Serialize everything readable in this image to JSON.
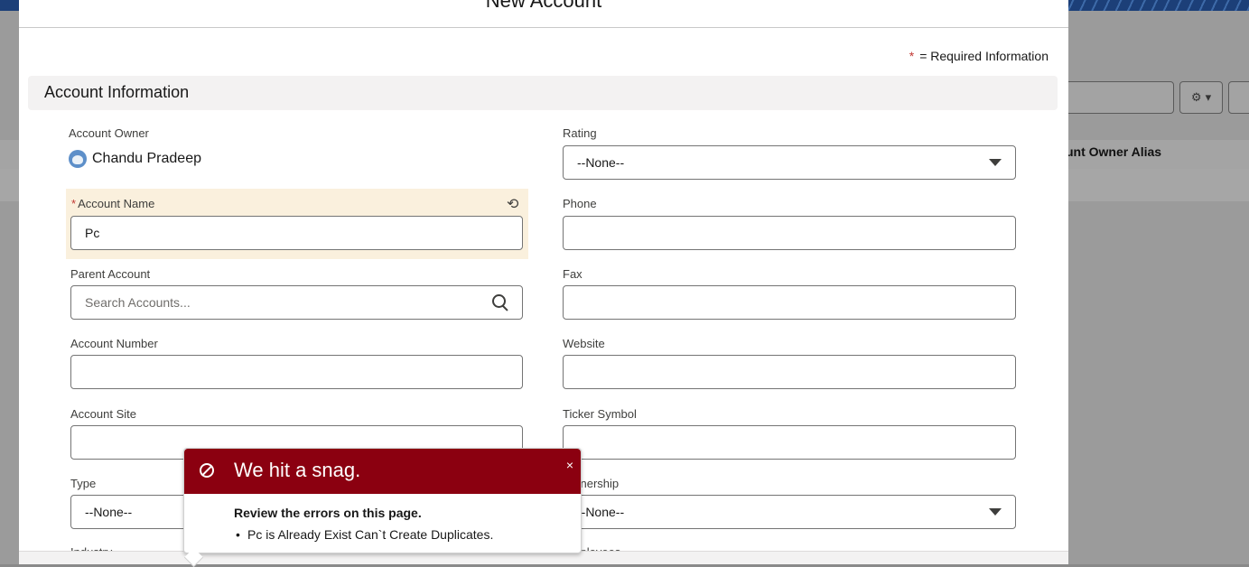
{
  "modal": {
    "title": "New Account",
    "required_star": "*",
    "required_text": "= Required Information",
    "section_title": "Account Information"
  },
  "fields": {
    "account_owner_label": "Account Owner",
    "account_owner_value": "Chandu Pradeep",
    "account_name_star": "*",
    "account_name_label": "Account Name",
    "account_name_value": "Pc",
    "parent_account_label": "Parent Account",
    "parent_account_placeholder": "Search Accounts...",
    "account_number_label": "Account Number",
    "account_site_label": "Account Site",
    "type_label": "Type",
    "type_value": "--None--",
    "industry_label": "Industry",
    "rating_label": "Rating",
    "rating_value": "--None--",
    "phone_label": "Phone",
    "fax_label": "Fax",
    "website_label": "Website",
    "ticker_label": "Ticker Symbol",
    "ownership_label": "Ownership",
    "ownership_value": "--None--",
    "employees_label": "Employees"
  },
  "error": {
    "title": "We hit a snag.",
    "close": "×",
    "body_title": "Review the errors on this page.",
    "items": [
      "Pc is Already Exist Can`t Create Duplicates."
    ]
  },
  "background": {
    "column_header": "unt Owner Alias"
  },
  "icons": {
    "undo": "undo-icon",
    "search": "search-icon",
    "error": "error-icon",
    "gear": "gear-icon"
  }
}
